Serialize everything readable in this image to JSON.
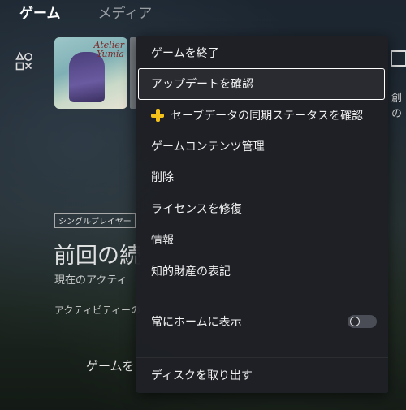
{
  "topnav": {
    "tabs": [
      "ゲーム",
      "メディア"
    ]
  },
  "game": {
    "tile_logo": "Atelier\nYumia",
    "category_badge": "シングルプレイヤー",
    "title_partial": "前回の続",
    "subtitle_partial": "現在のアクティ",
    "activity_partial": "アクティビティーの",
    "start_partial": "ゲームを",
    "right_partial": "創の"
  },
  "menu": {
    "items": [
      {
        "label": "ゲームを終了"
      },
      {
        "label": "アップデートを確認"
      },
      {
        "label": "セーブデータの同期ステータスを確認"
      },
      {
        "label": "ゲームコンテンツ管理"
      },
      {
        "label": "削除"
      },
      {
        "label": "ライセンスを修復"
      },
      {
        "label": "情報"
      },
      {
        "label": "知的財産の表記"
      }
    ],
    "always_show_home": {
      "label": "常にホームに表示",
      "enabled": false
    },
    "eject": {
      "label": "ディスクを取り出す"
    },
    "selected_item": "アップデートを確認"
  },
  "colors": {
    "ps_plus": "#f4c21a",
    "menu_bg": "#1e2025"
  }
}
